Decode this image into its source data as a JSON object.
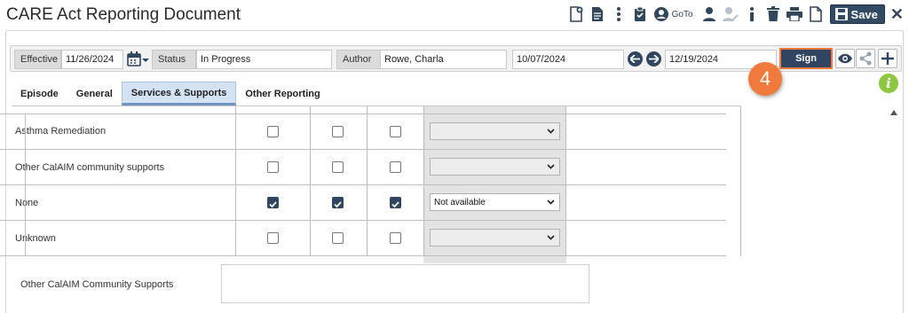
{
  "window": {
    "title": "CARE Act Reporting Document"
  },
  "toolbar": {
    "goto_label": "GoTo",
    "save_label": "Save",
    "icons": [
      "new-document-icon",
      "document-icon",
      "more-icon",
      "clipboard-icon",
      "user-circle-icon",
      "person-icon",
      "person-edit-icon",
      "info-icon",
      "trash-icon",
      "print-icon",
      "page-icon",
      "save-icon",
      "close-icon"
    ]
  },
  "header": {
    "effective_label": "Effective",
    "effective_value": "11/26/2024",
    "status_label": "Status",
    "status_value": "In Progress",
    "author_label": "Author",
    "author_value": "Rowe, Charla",
    "date_from": "10/07/2024",
    "date_to": "12/19/2024",
    "sign_label": "Sign"
  },
  "callout": {
    "step": "4"
  },
  "info_label": "i",
  "tabs": [
    {
      "label": "Episode",
      "active": false
    },
    {
      "label": "General",
      "active": false
    },
    {
      "label": "Services & Supports",
      "active": true
    },
    {
      "label": "Other Reporting",
      "active": false
    }
  ],
  "rows": [
    {
      "name": "Asthma Remediation",
      "checks": [
        false,
        false,
        false
      ],
      "select": "",
      "enabled": false
    },
    {
      "name": "Other CalAIM community supports",
      "checks": [
        false,
        false,
        false
      ],
      "select": "",
      "enabled": false
    },
    {
      "name": "None",
      "checks": [
        true,
        true,
        true
      ],
      "select": "Not available",
      "enabled": true
    },
    {
      "name": "Unknown",
      "checks": [
        false,
        false,
        false
      ],
      "select": "",
      "enabled": false
    }
  ],
  "other_supports": {
    "label": "Other CalAIM Community Supports",
    "value": ""
  },
  "colors": {
    "accent": "#2f4560",
    "callout": "#f07a3c",
    "tab_active": "#d4e3f3",
    "info": "#8dc63f"
  }
}
